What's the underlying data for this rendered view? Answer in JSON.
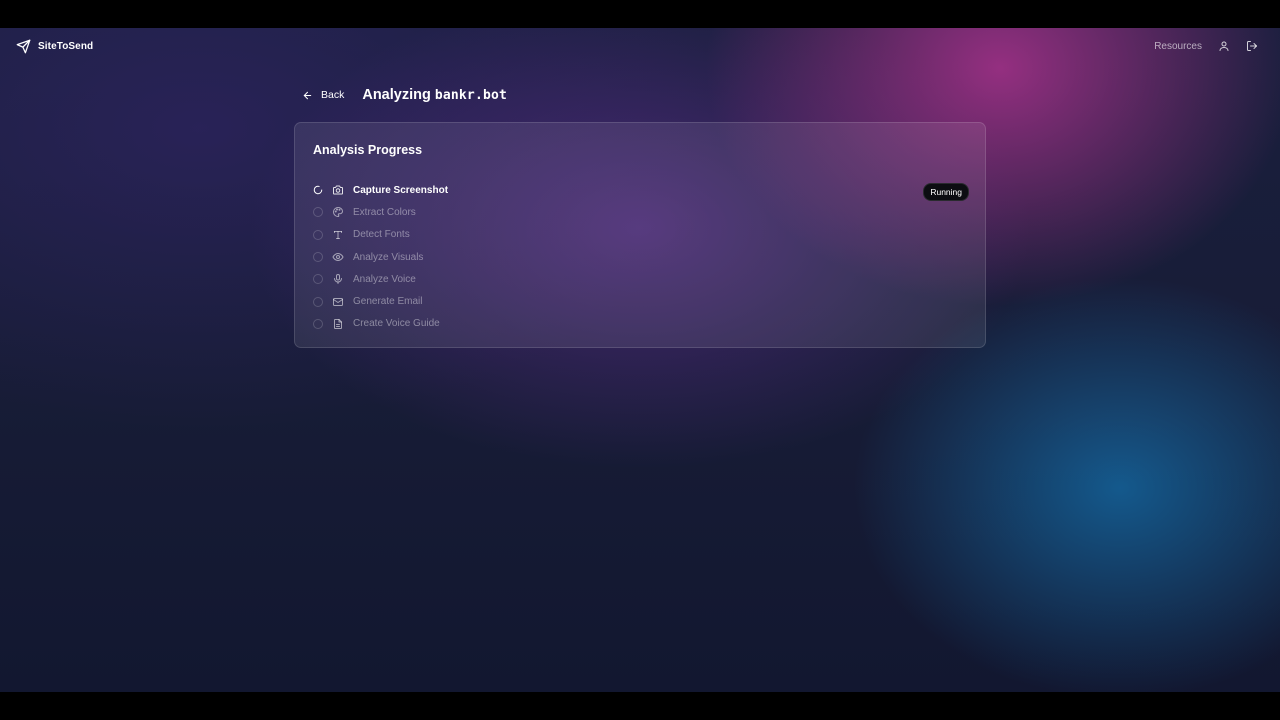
{
  "app": {
    "brand": "SiteToSend"
  },
  "nav": {
    "resources": "Resources"
  },
  "page": {
    "back_label": "Back",
    "title_prefix": "Analyzing",
    "title_domain": "bankr.bot"
  },
  "card": {
    "title": "Analysis Progress"
  },
  "steps": [
    {
      "label": "Capture Screenshot",
      "icon": "camera-icon",
      "status": "running",
      "badge": "Running"
    },
    {
      "label": "Extract Colors",
      "icon": "palette-icon",
      "status": "pending"
    },
    {
      "label": "Detect Fonts",
      "icon": "type-icon",
      "status": "pending"
    },
    {
      "label": "Analyze Visuals",
      "icon": "eye-icon",
      "status": "pending"
    },
    {
      "label": "Analyze Voice",
      "icon": "mic-icon",
      "status": "pending"
    },
    {
      "label": "Generate Email",
      "icon": "mail-icon",
      "status": "pending"
    },
    {
      "label": "Create Voice Guide",
      "icon": "file-text-icon",
      "status": "pending"
    }
  ],
  "colors": {
    "badge_bg": "#0c0d12",
    "bg_base": "#1a1f3e",
    "glow_magenta": "#aa328c",
    "glow_blue": "#146eaa"
  }
}
